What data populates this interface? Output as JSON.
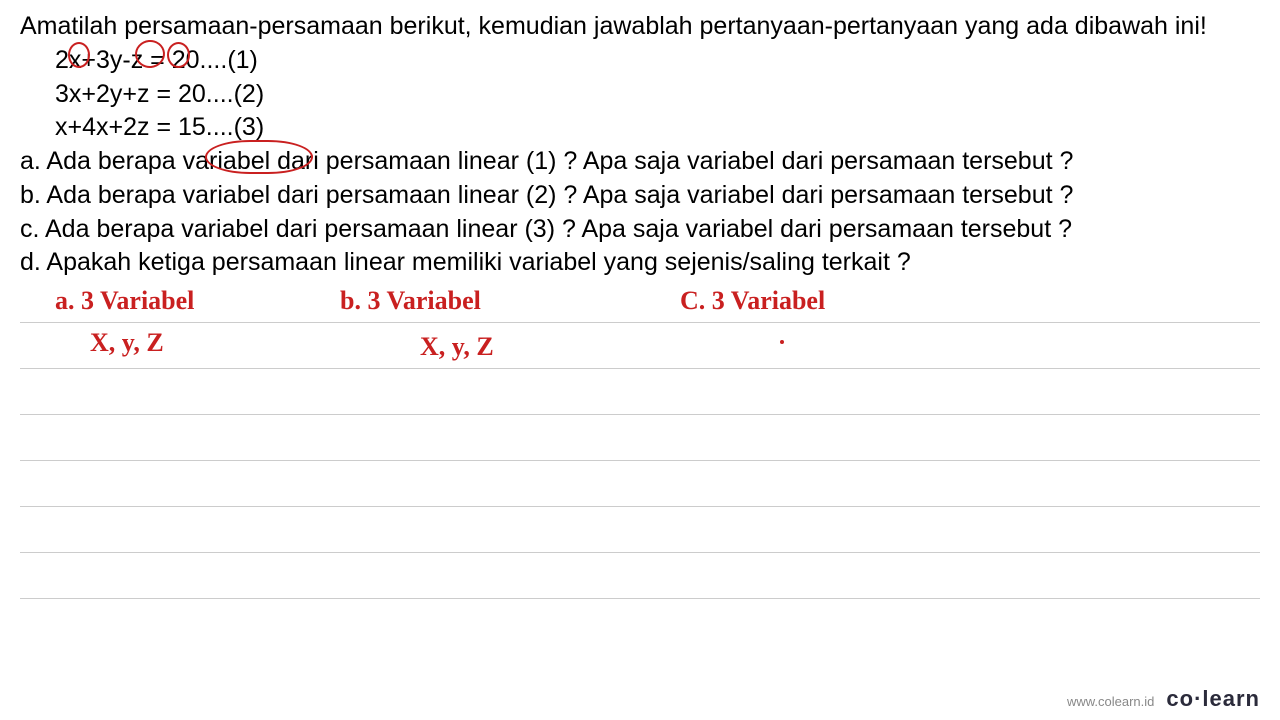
{
  "problem": {
    "intro": "Amatilah persamaan-persamaan berikut, kemudian jawablah pertanyaan-pertanyaan yang ada dibawah ini!",
    "equations": {
      "eq1": "2x+3y-z = 20....(1)",
      "eq2": "3x+2y+z = 20....(2)",
      "eq3": "x+4x+2z = 15....(3)"
    },
    "questions": {
      "a": "a. Ada berapa variabel dari persamaan linear (1) ? Apa saja variabel dari persamaan tersebut ?",
      "b": "b. Ada berapa variabel dari persamaan linear (2) ? Apa saja variabel dari persamaan tersebut ?",
      "c": "c. Ada berapa variabel dari persamaan linear (3) ? Apa saja variabel dari persamaan tersebut ?",
      "d": "d. Apakah ketiga persamaan linear memiliki variabel yang sejenis/saling terkait ?"
    }
  },
  "handwritten_answers": {
    "a_label": "a. 3 Variabel",
    "a_vars": "X, y, Z",
    "b_label": "b.  3 Variabel",
    "b_vars": "X, y, Z",
    "c_label": "C. 3 Variabel"
  },
  "footer": {
    "url": "www.colearn.id",
    "logo": "co·learn"
  }
}
